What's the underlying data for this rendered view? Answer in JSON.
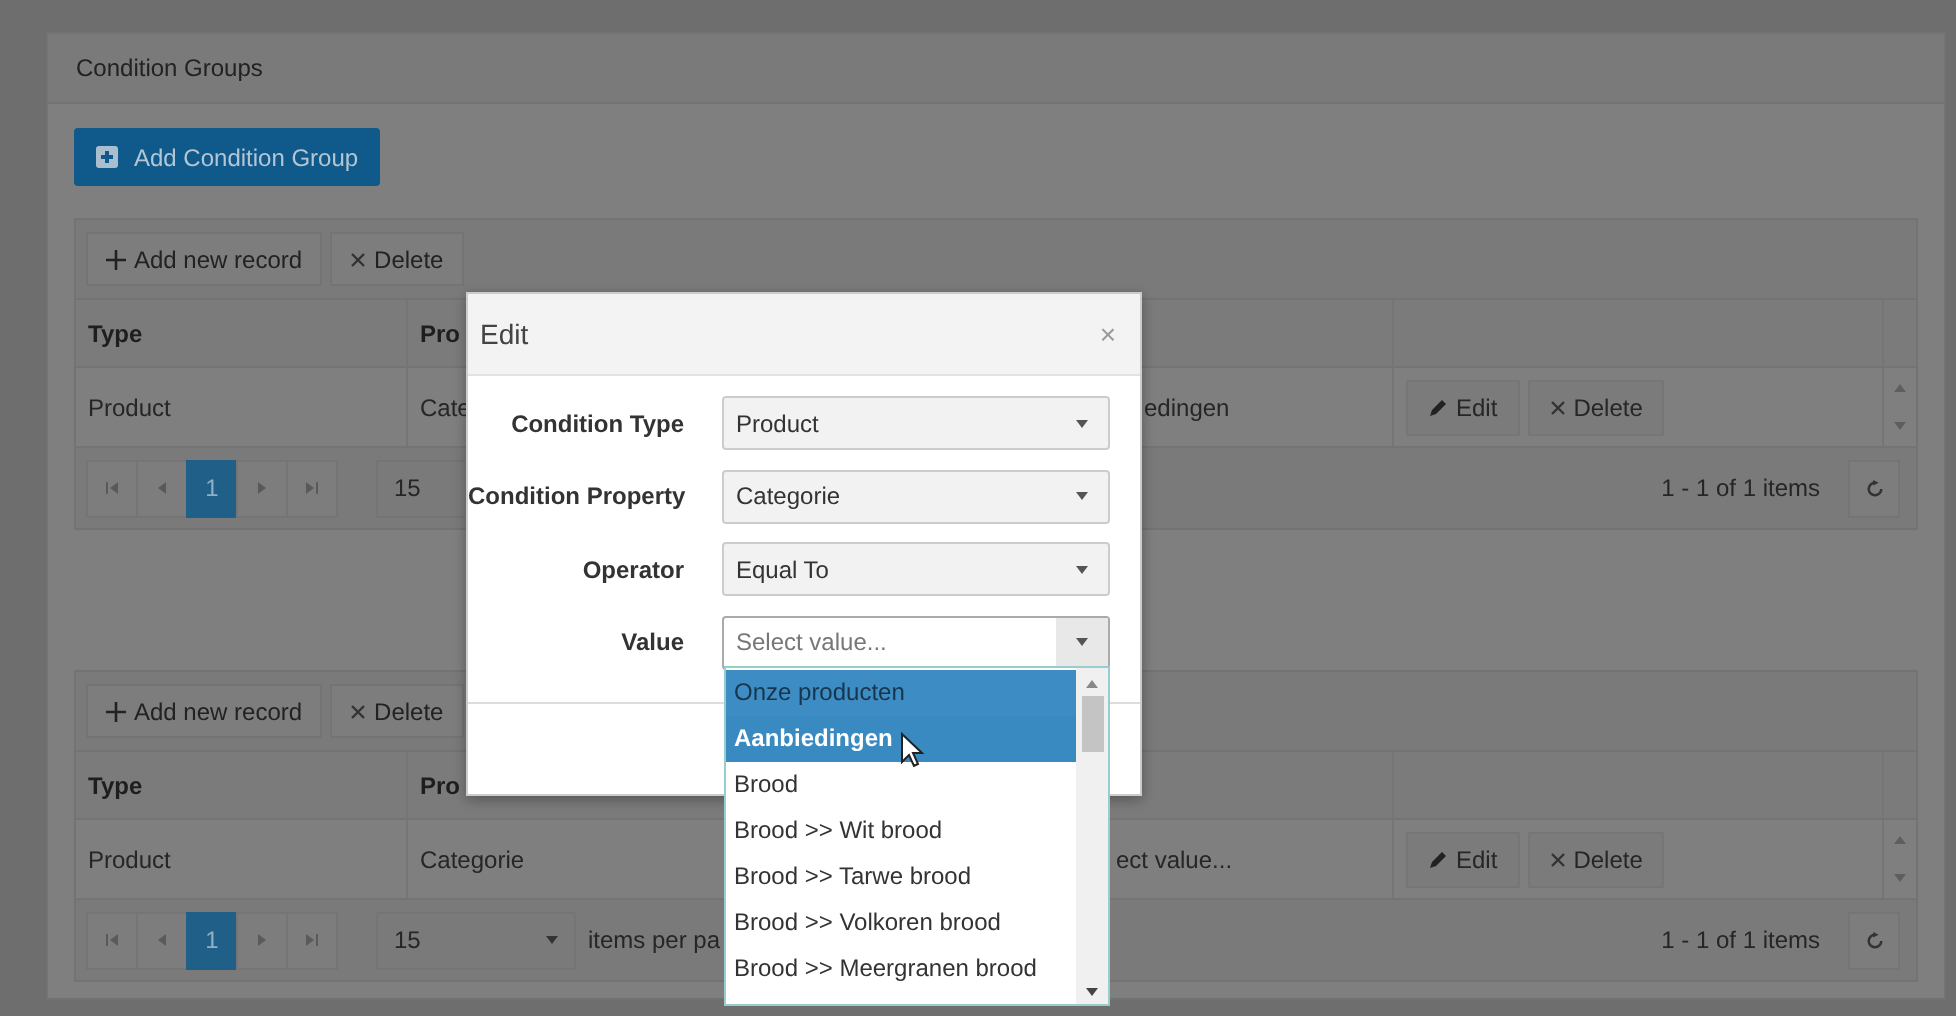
{
  "panel": {
    "title": "Condition Groups"
  },
  "add_button": {
    "label": "Add Condition Group"
  },
  "grids": [
    {
      "toolbar": [
        {
          "kind": "add",
          "label": "Add new record"
        },
        {
          "kind": "delete",
          "label": "Delete"
        }
      ],
      "columns": [
        "Type",
        "Pro"
      ],
      "rows": [
        {
          "cells": [
            "Product",
            "Cate",
            "edingen"
          ],
          "actions": [
            {
              "kind": "edit",
              "label": "Edit"
            },
            {
              "kind": "delete",
              "label": "Delete"
            }
          ]
        }
      ],
      "pager": {
        "pages": [
          {
            "label": "1",
            "selected": true
          }
        ],
        "page_size": "15",
        "info": "1 - 1 of 1 items"
      }
    },
    {
      "toolbar": [
        {
          "kind": "add",
          "label": "Add new record"
        },
        {
          "kind": "delete",
          "label": "Delete"
        }
      ],
      "columns": [
        "Type",
        "Pro"
      ],
      "rows": [
        {
          "cells": [
            "Product",
            "Categorie",
            "ect value..."
          ],
          "actions": [
            {
              "kind": "edit",
              "label": "Edit"
            },
            {
              "kind": "delete",
              "label": "Delete"
            }
          ]
        }
      ],
      "pager": {
        "pages": [
          {
            "label": "1",
            "selected": true
          }
        ],
        "page_size": "15",
        "page_size_label": "items per pa",
        "info": "1 - 1 of 1 items"
      }
    }
  ],
  "modal": {
    "title": "Edit",
    "close": "×",
    "fields": [
      {
        "label": "Condition Type",
        "value": "Product"
      },
      {
        "label": "Condition Property",
        "value": "Categorie"
      },
      {
        "label": "Operator",
        "value": "Equal To"
      },
      {
        "label": "Value",
        "placeholder": "Select value...",
        "open": true
      }
    ]
  },
  "dropdown": {
    "options": [
      {
        "label": "Onze producten",
        "selected": true,
        "hovered": false
      },
      {
        "label": "Aanbiedingen",
        "selected": false,
        "hovered": true
      },
      {
        "label": "Brood",
        "selected": false,
        "hovered": false
      },
      {
        "label": "Brood >> Wit brood",
        "selected": false,
        "hovered": false
      },
      {
        "label": "Brood >> Tarwe brood",
        "selected": false,
        "hovered": false
      },
      {
        "label": "Brood >> Volkoren brood",
        "selected": false,
        "hovered": false
      },
      {
        "label": "Brood >> Meergranen brood",
        "selected": false,
        "hovered": false
      }
    ]
  }
}
